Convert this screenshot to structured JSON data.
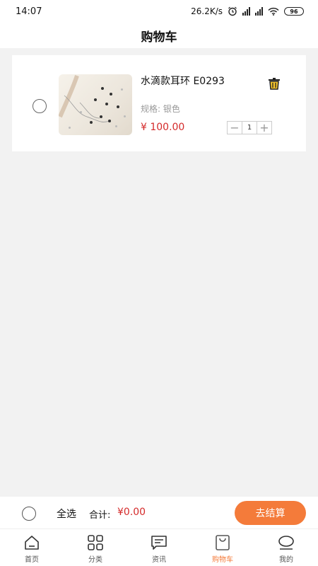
{
  "status": {
    "time": "14:07",
    "speed": "26.2K/s",
    "battery": "96"
  },
  "header": {
    "title": "购物车"
  },
  "cart": {
    "items": [
      {
        "title": "水滴款耳环 E0293",
        "spec": "规格: 银色",
        "price": "¥ 100.00",
        "qty": "1"
      }
    ]
  },
  "checkout": {
    "select_all": "全选",
    "total_label": "合计:",
    "total_value": "¥0.00",
    "button": "去结算"
  },
  "tabs": [
    {
      "label": "首页",
      "icon": "home-icon"
    },
    {
      "label": "分类",
      "icon": "grid-icon"
    },
    {
      "label": "资讯",
      "icon": "news-icon"
    },
    {
      "label": "购物车",
      "icon": "cart-icon",
      "active": true
    },
    {
      "label": "我的",
      "icon": "profile-icon"
    }
  ],
  "colors": {
    "accent": "#f47b3a",
    "price": "#d42a2a",
    "background": "#f2f2f2"
  }
}
